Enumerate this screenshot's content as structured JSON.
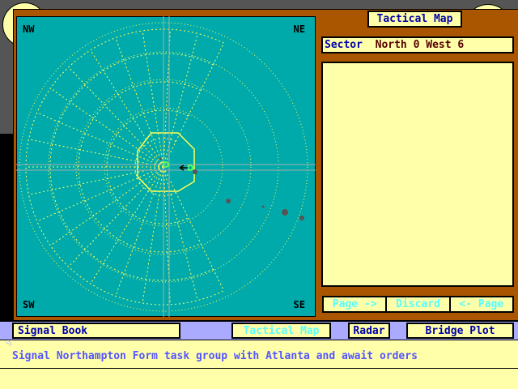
{
  "map": {
    "corners": {
      "nw": "NW",
      "ne": "NE",
      "sw": "SW",
      "se": "SE"
    }
  },
  "panel": {
    "title": "Tactical Map",
    "sector_label": "Sector",
    "sector_value": "North 0 West 6",
    "buttons": {
      "page_forward": "Page ->",
      "discard": "Discard",
      "page_back": "<- Page"
    }
  },
  "toolbar": {
    "signal_book": "Signal Book",
    "tactical_map": "Tactical Map",
    "radar": "Radar",
    "bridge_plot": "Bridge Plot"
  },
  "message": "Signal Northampton Form task group with Atlanta and await orders",
  "colors": {
    "teal": "#00AAAA",
    "brown": "#AA5500",
    "yellow": "#FFFFAA",
    "blue_text": "#0000AA",
    "dim_text": "#55FFFF"
  }
}
